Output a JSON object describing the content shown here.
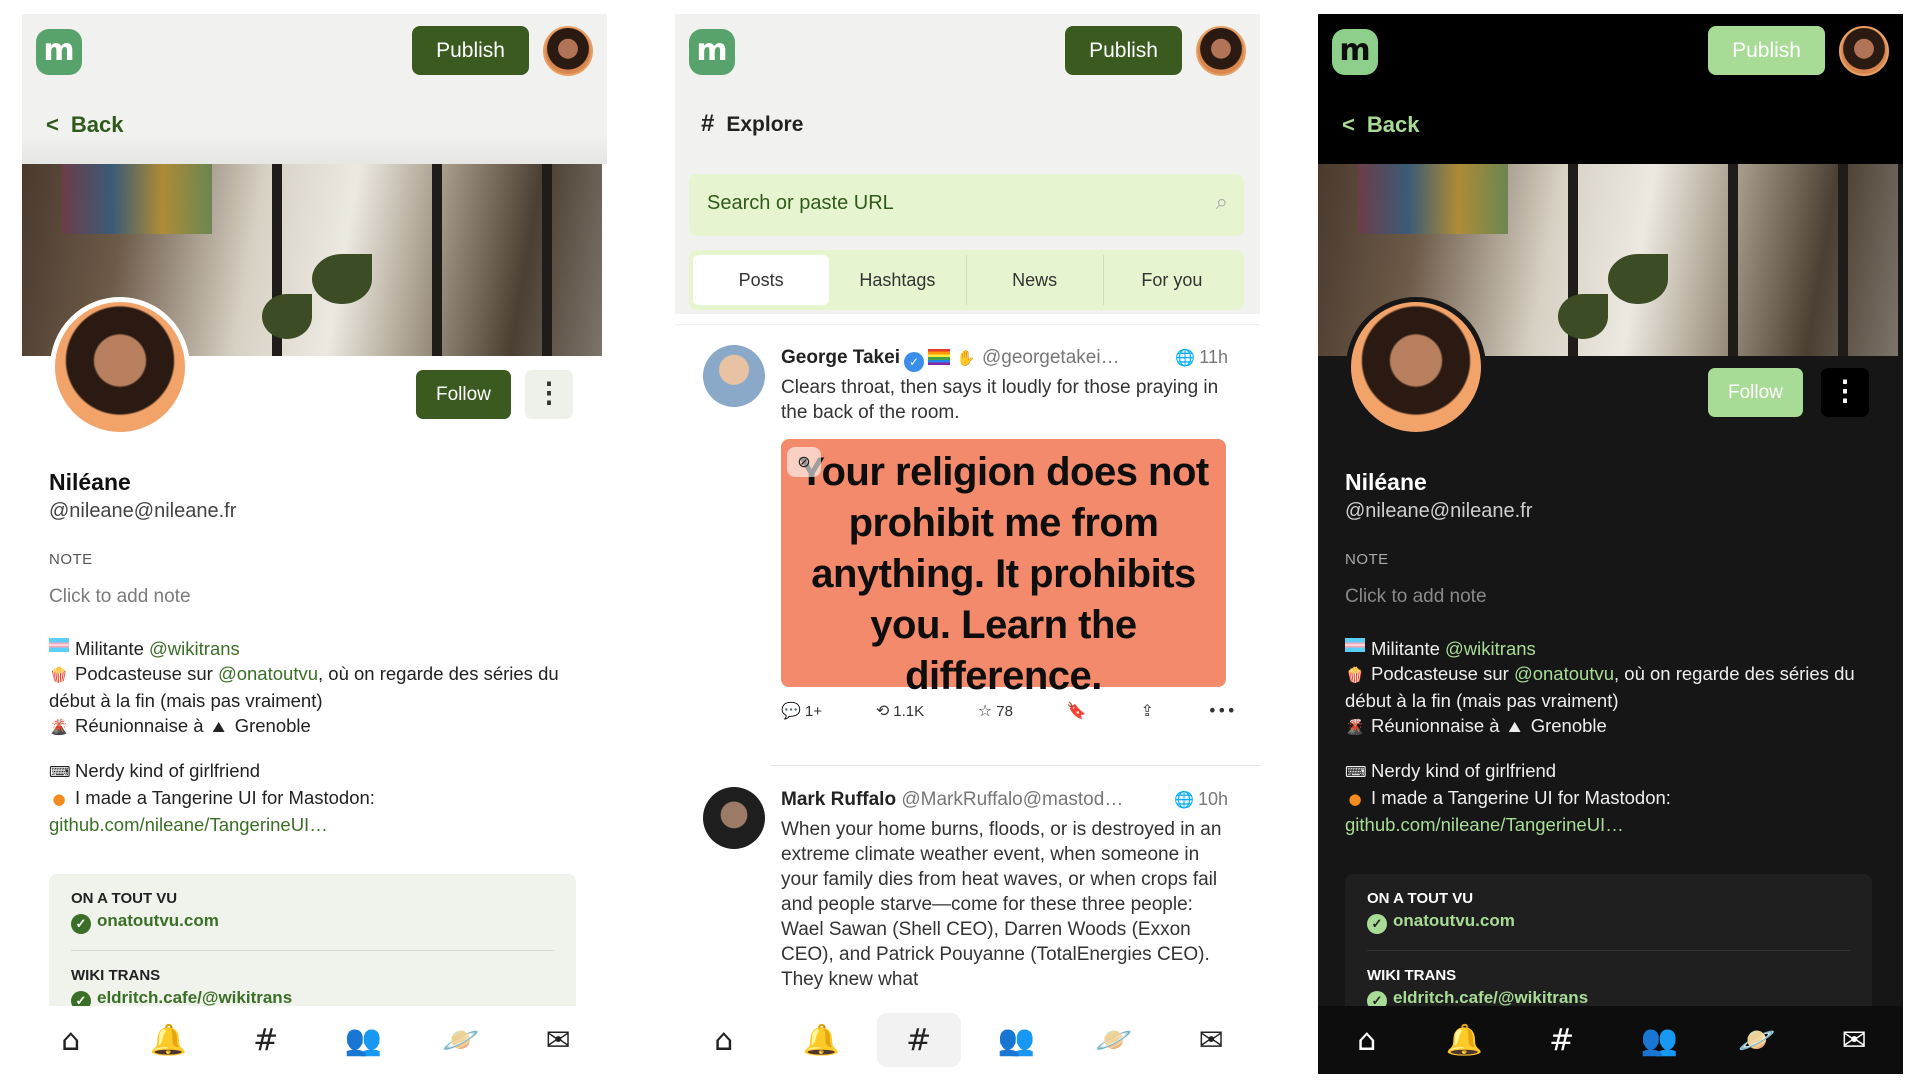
{
  "profile": {
    "publish_label": "Publish",
    "back_label": "Back",
    "follow_label": "Follow",
    "more_icon": "⋮",
    "name": "Niléane",
    "handle": "@nileane@nileane.fr",
    "note_label": "NOTE",
    "note_placeholder": "Click to add note",
    "bio": {
      "l1_pre": "Militante ",
      "l1_mention": "@wikitrans",
      "l2_pre": "Podcasteuse sur ",
      "l2_mention": "@onatoutvu",
      "l2_post": ", où on regarde des séries du début à la fin (mais pas vraiment)",
      "l3_pre": "Réunionnaise à ",
      "l3_post": "Grenoble",
      "l4": "Nerdy kind of girlfriend",
      "l5": "I made a Tangerine UI for Mastodon:",
      "l6_link": "github.com/nileane/TangerineUI…"
    },
    "fields": [
      {
        "label": "ON A TOUT VU",
        "value": "onatoutvu.com"
      },
      {
        "label": "WIKI TRANS",
        "value": "eldritch.cafe/@wikitrans"
      }
    ]
  },
  "explore": {
    "publish_label": "Publish",
    "title": "Explore",
    "search_placeholder": "Search or paste URL",
    "tabs": [
      "Posts",
      "Hashtags",
      "News",
      "For you"
    ],
    "posts": [
      {
        "name": "George Takei",
        "user": "@georgetakei…",
        "time": "11h",
        "text": "Clears throat, then says it loudly for those praying in the back of the room.",
        "media_lines": [
          "Your religion does not",
          "prohibit me from",
          "anything. It prohibits",
          "you. Learn the",
          "difference."
        ],
        "replies": "1+",
        "boosts": "1.1K",
        "favs": "78"
      },
      {
        "name": "Mark Ruffalo",
        "user": "@MarkRuffalo@mastod…",
        "time": "10h",
        "text": "When your home burns, floods, or is destroyed in an extreme climate weather event, when someone in your family dies from heat waves, or when crops fail and people starve—come for these three people: Wael Sawan (Shell CEO), Darren Woods (Exxon CEO), and Patrick Pouyanne (TotalEnergies CEO). They knew what"
      }
    ]
  },
  "nav": [
    "⌂",
    "🔔",
    "#",
    "👥",
    "🪐",
    "✉"
  ]
}
